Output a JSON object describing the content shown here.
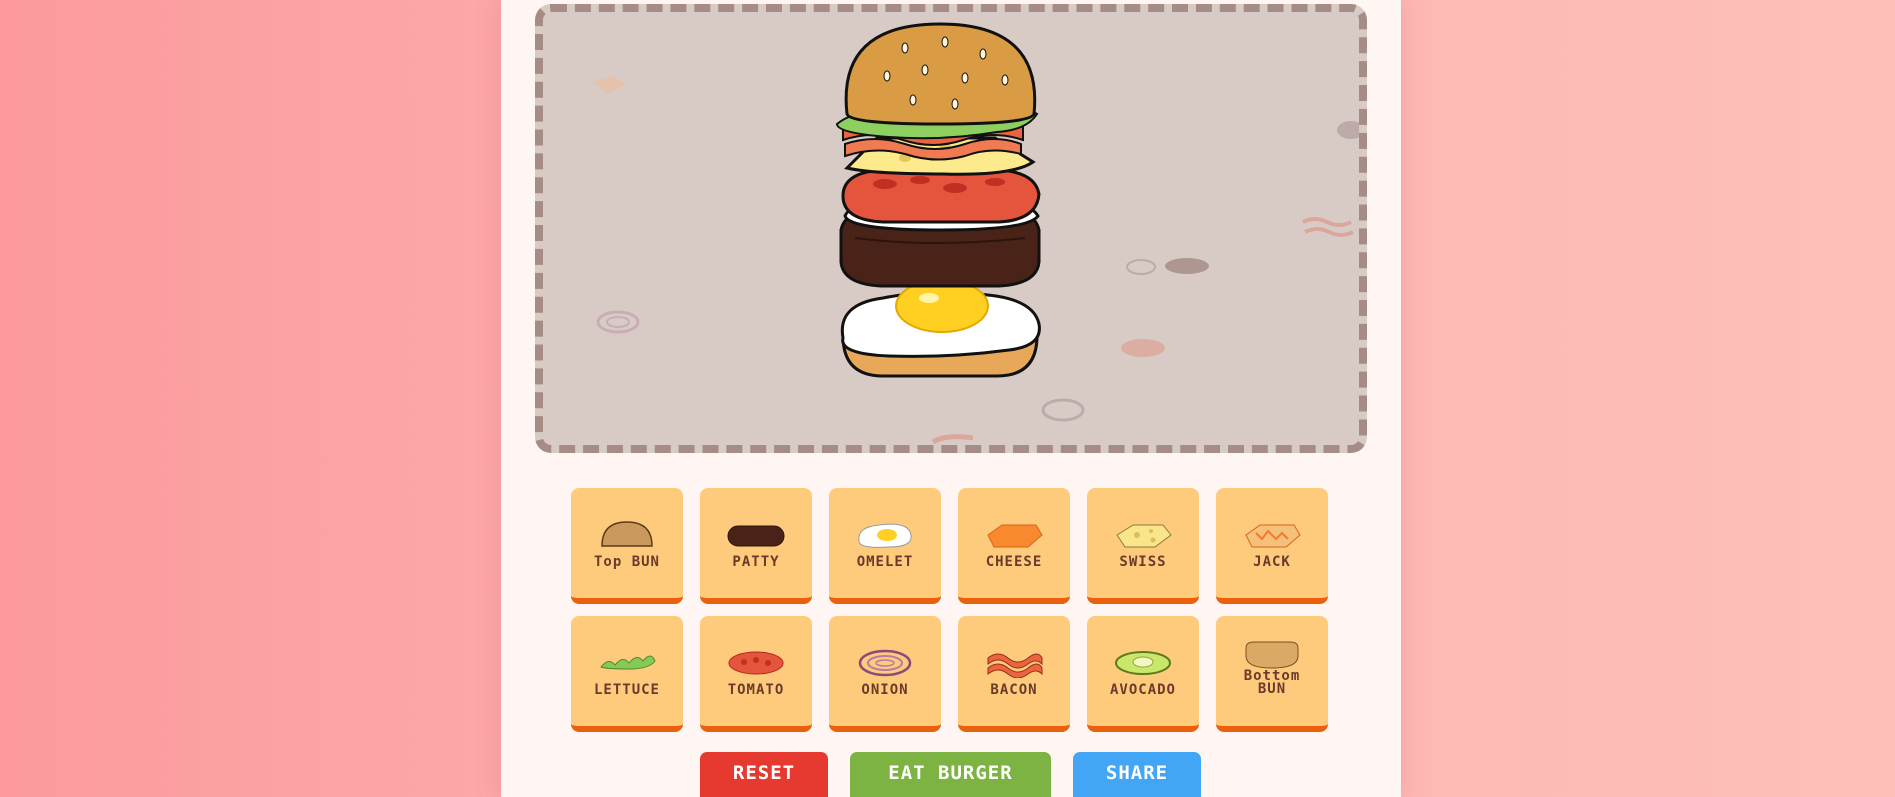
{
  "ingredients": [
    {
      "label": "Top BUN",
      "icon": "top-bun-icon"
    },
    {
      "label": "PATTY",
      "icon": "patty-icon"
    },
    {
      "label": "OMELET",
      "icon": "omelet-icon"
    },
    {
      "label": "CHEESE",
      "icon": "cheese-icon"
    },
    {
      "label": "SWISS",
      "icon": "swiss-cheese-icon"
    },
    {
      "label": "JACK",
      "icon": "jack-cheese-icon"
    },
    {
      "label": "LETTUCE",
      "icon": "lettuce-icon"
    },
    {
      "label": "TOMATO",
      "icon": "tomato-icon"
    },
    {
      "label": "ONION",
      "icon": "onion-icon"
    },
    {
      "label": "BACON",
      "icon": "bacon-icon"
    },
    {
      "label": "AVOCADO",
      "icon": "avocado-icon"
    },
    {
      "label": "Bottom BUN",
      "icon": "bottom-bun-icon"
    }
  ],
  "burger_stack": [
    "Top BUN",
    "LETTUCE",
    "BACON",
    "CHEESE",
    "TOMATO",
    "ONION",
    "PATTY",
    "OMELET",
    "Bottom BUN"
  ],
  "actions": {
    "reset_label": "RESET",
    "eat_label": "EAT BURGER",
    "share_label": "SHARE"
  },
  "colors": {
    "button_face": "#fecb7d",
    "button_edge": "#e9600d",
    "reset": "#e63a30",
    "eat": "#7cb342",
    "share": "#42a5f5",
    "stage_bg": "#d8cbc6",
    "stage_border": "#a58d85"
  }
}
